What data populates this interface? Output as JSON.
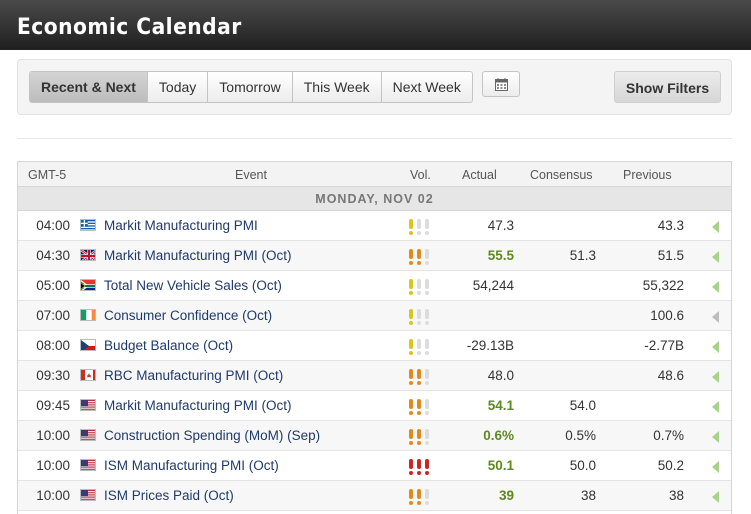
{
  "header": {
    "title": "Economic Calendar"
  },
  "toolbar": {
    "tabs": [
      "Recent & Next",
      "Today",
      "Tomorrow",
      "This Week",
      "Next Week"
    ],
    "active_tab": 0,
    "calendar_icon": "calendar-icon",
    "filters_label": "Show Filters"
  },
  "table": {
    "headers": {
      "timezone": "GMT-5",
      "event": "Event",
      "vol": "Vol.",
      "actual": "Actual",
      "consensus": "Consensus",
      "previous": "Previous"
    },
    "day": "MONDAY, NOV 02",
    "rows": [
      {
        "time": "04:00",
        "country": "Greece",
        "event": "Markit Manufacturing PMI",
        "vol": 1,
        "actual": "47.3",
        "actual_better": false,
        "consensus": "",
        "previous": "43.3",
        "trend": "green"
      },
      {
        "time": "04:30",
        "country": "United Kingdom",
        "event": "Markit Manufacturing PMI (Oct)",
        "vol": 2,
        "actual": "55.5",
        "actual_better": true,
        "consensus": "51.3",
        "previous": "51.5",
        "trend": "green"
      },
      {
        "time": "05:00",
        "country": "South Africa",
        "event": "Total New Vehicle Sales (Oct)",
        "vol": 1,
        "actual": "54,244",
        "actual_better": false,
        "consensus": "",
        "previous": "55,322",
        "trend": "green"
      },
      {
        "time": "07:00",
        "country": "Ireland",
        "event": "Consumer Confidence (Oct)",
        "vol": 1,
        "actual": "",
        "actual_better": false,
        "consensus": "",
        "previous": "100.6",
        "trend": "grey"
      },
      {
        "time": "08:00",
        "country": "Czech Republic",
        "event": "Budget Balance (Oct)",
        "vol": 1,
        "actual": "-29.13B",
        "actual_better": false,
        "consensus": "",
        "previous": "-2.77B",
        "trend": "green"
      },
      {
        "time": "09:30",
        "country": "Canada",
        "event": "RBC Manufacturing PMI (Oct)",
        "vol": 2,
        "actual": "48.0",
        "actual_better": false,
        "consensus": "",
        "previous": "48.6",
        "trend": "green"
      },
      {
        "time": "09:45",
        "country": "United States",
        "event": "Markit Manufacturing PMI (Oct)",
        "vol": 2,
        "actual": "54.1",
        "actual_better": true,
        "consensus": "54.0",
        "previous": "",
        "trend": "green"
      },
      {
        "time": "10:00",
        "country": "United States",
        "event": "Construction Spending (MoM) (Sep)",
        "vol": 2,
        "actual": "0.6%",
        "actual_better": true,
        "consensus": "0.5%",
        "previous": "0.7%",
        "trend": "green"
      },
      {
        "time": "10:00",
        "country": "United States",
        "event": "ISM Manufacturing PMI (Oct)",
        "vol": 3,
        "actual": "50.1",
        "actual_better": true,
        "consensus": "50.0",
        "previous": "50.2",
        "trend": "green"
      },
      {
        "time": "10:00",
        "country": "United States",
        "event": "ISM Prices Paid (Oct)",
        "vol": 2,
        "actual": "39",
        "actual_better": true,
        "consensus": "38",
        "previous": "38",
        "trend": "green"
      }
    ]
  }
}
